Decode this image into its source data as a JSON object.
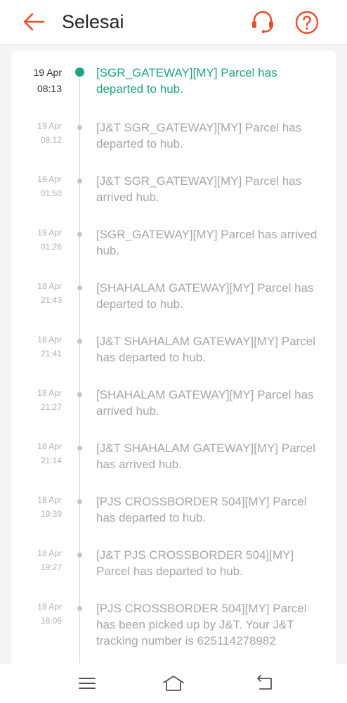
{
  "header": {
    "title": "Selesai",
    "accent_color": "#e8502d",
    "back_icon": "arrow-left-icon",
    "support_icon": "headset-icon",
    "help_icon": "question-circle-icon"
  },
  "timeline": {
    "active_color": "#1fa387",
    "events": [
      {
        "date": "19 Apr",
        "time": "08:13",
        "message": "[SGR_GATEWAY][MY] Parcel has departed to hub."
      },
      {
        "date": "19 Apr",
        "time": "08:12",
        "message": "[J&T SGR_GATEWAY][MY] Parcel has departed to hub."
      },
      {
        "date": "19 Apr",
        "time": "01:50",
        "message": "[J&T SGR_GATEWAY][MY] Parcel has arrived hub."
      },
      {
        "date": "19 Apr",
        "time": "01:26",
        "message": "[SGR_GATEWAY][MY] Parcel has arrived hub."
      },
      {
        "date": "18 Apr",
        "time": "21:43",
        "message": "[SHAHALAM GATEWAY][MY] Parcel has departed to hub."
      },
      {
        "date": "18 Apr",
        "time": "21:41",
        "message": "[J&T SHAHALAM GATEWAY][MY] Parcel has departed to hub."
      },
      {
        "date": "18 Apr",
        "time": "21:27",
        "message": "[SHAHALAM GATEWAY][MY] Parcel has arrived hub."
      },
      {
        "date": "18 Apr",
        "time": "21:14",
        "message": "[J&T SHAHALAM GATEWAY][MY] Parcel has arrived hub."
      },
      {
        "date": "18 Apr",
        "time": "19:39",
        "message": "[PJS CROSSBORDER 504][MY] Parcel has departed to hub."
      },
      {
        "date": "18 Apr",
        "time": "19:27",
        "message": "[J&T PJS CROSSBORDER 504][MY] Parcel has departed to hub."
      },
      {
        "date": "18 Apr",
        "time": "18:05",
        "message": "[PJS CROSSBORDER 504][MY] Parcel has been picked up by J&T. Your J&T tracking number is 625114278982"
      }
    ]
  },
  "navbar": {
    "menu_icon": "menu-icon",
    "home_icon": "home-icon",
    "back_icon": "back-icon"
  }
}
